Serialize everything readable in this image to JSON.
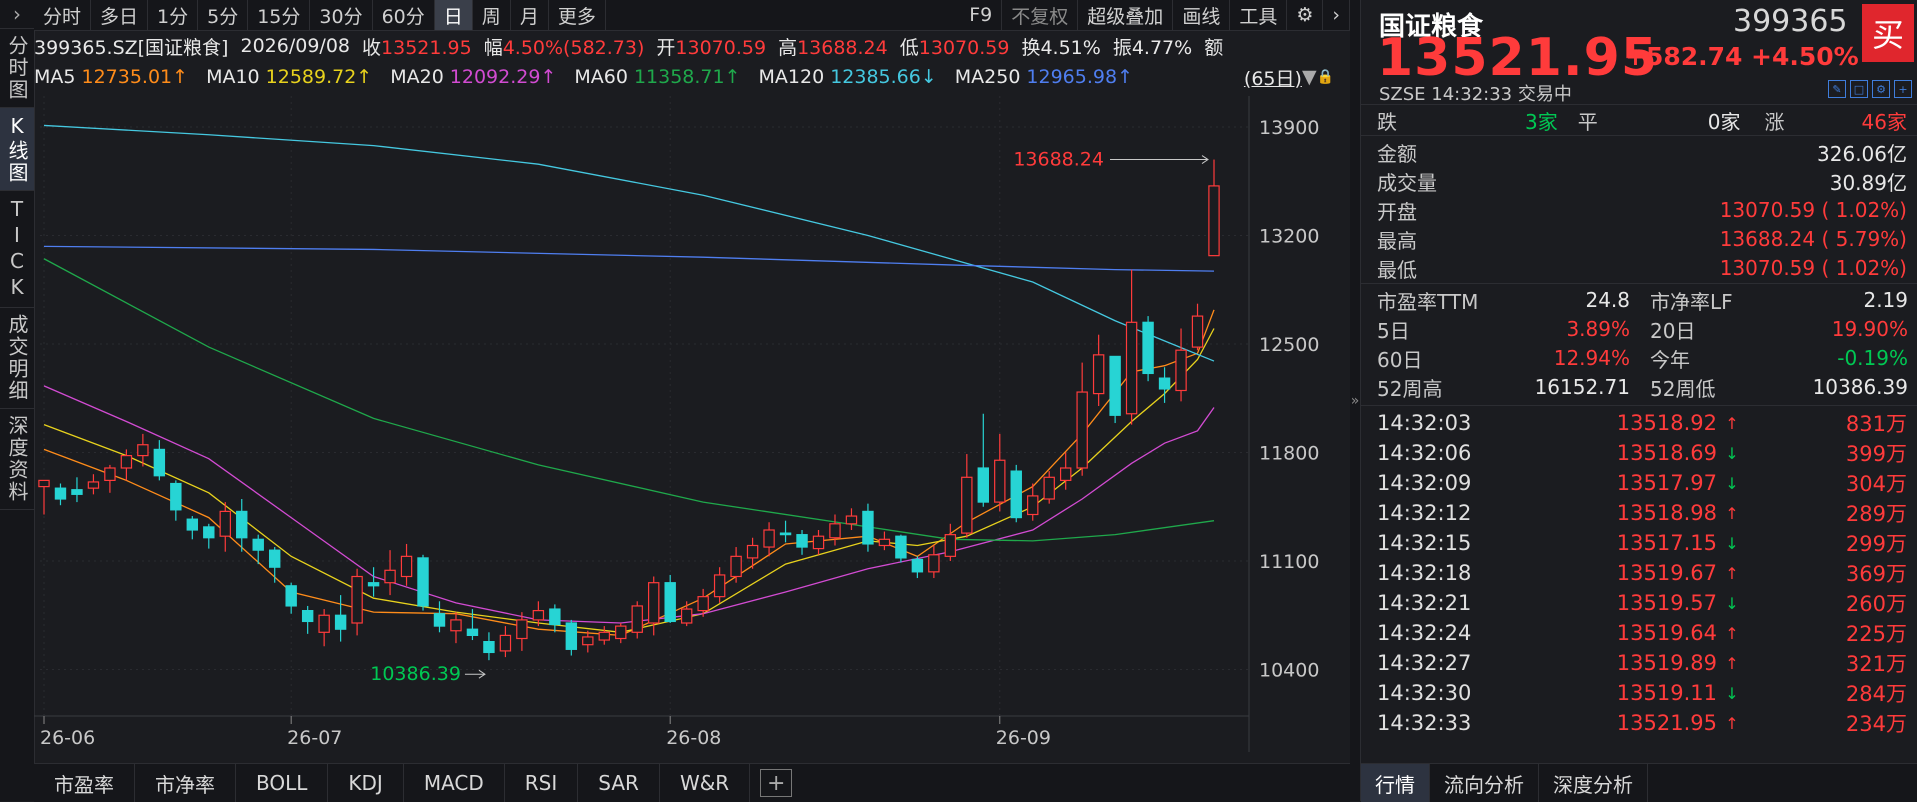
{
  "left_tabs": [
    {
      "label": "分时图"
    },
    {
      "label": "K线图",
      "active": true
    },
    {
      "label": "TICK"
    },
    {
      "label": "成交明细"
    },
    {
      "label": "深度资料"
    }
  ],
  "toolbar": {
    "periods": [
      "分时",
      "多日",
      "1分",
      "5分",
      "15分",
      "30分",
      "60分",
      "日",
      "周",
      "月",
      "更多"
    ],
    "active_period": "日",
    "right": [
      "F9",
      "不复权",
      "超级叠加",
      "画线",
      "工具"
    ],
    "gear_icon": "gear-icon",
    "next_icon": "chevron-right-icon",
    "collapse_icon": "chevron-right-icon"
  },
  "info": {
    "code_name": "399365.SZ[国证粮食]",
    "date": "2026/09/08",
    "close_label": "收",
    "close": "13521.95",
    "range_label": "幅",
    "range": "4.50%(582.73)",
    "open_label": "开",
    "open": "13070.59",
    "high_label": "高",
    "high": "13688.24",
    "low_label": "低",
    "low": "13070.59",
    "turnover_label": "换",
    "turnover": "4.51%",
    "amplitude_label": "振",
    "amplitude": "4.77%",
    "amount_label": "额"
  },
  "ma": {
    "items": [
      {
        "name": "MA5",
        "value": "12735.01↑",
        "color": "#ff8c1a"
      },
      {
        "name": "MA10",
        "value": "12589.72↑",
        "color": "#e8d21d"
      },
      {
        "name": "MA20",
        "value": "12092.29↑",
        "color": "#d24bd2"
      },
      {
        "name": "MA60",
        "value": "11358.71↑",
        "color": "#1fa84b"
      },
      {
        "name": "MA120",
        "value": "12385.66↓",
        "color": "#45c8e0"
      },
      {
        "name": "MA250",
        "value": "12965.98↑",
        "color": "#4f7ef0"
      }
    ],
    "days": "(65日)"
  },
  "chart_data": {
    "type": "candlestick",
    "ylim": [
      10100,
      14100
    ],
    "y_ticks": [
      "13900",
      "13200",
      "12500",
      "11800",
      "11100",
      "10400"
    ],
    "x_labels": [
      {
        "index": 0,
        "label": "26-06"
      },
      {
        "index": 15,
        "label": "26-07"
      },
      {
        "index": 38,
        "label": "26-08"
      },
      {
        "index": 58,
        "label": "26-09"
      }
    ],
    "max_label": "13688.24",
    "min_label": "10386.39",
    "candles": [
      [
        11580,
        11620,
        11400,
        11620
      ],
      [
        11570,
        11500,
        11460,
        11600
      ],
      [
        11560,
        11530,
        11480,
        11640
      ],
      [
        11570,
        11610,
        11530,
        11660
      ],
      [
        11620,
        11700,
        11540,
        11720
      ],
      [
        11700,
        11780,
        11620,
        11820
      ],
      [
        11780,
        11850,
        11710,
        11920
      ],
      [
        11820,
        11650,
        11620,
        11880
      ],
      [
        11600,
        11430,
        11360,
        11620
      ],
      [
        11370,
        11300,
        11240,
        11390
      ],
      [
        11320,
        11250,
        11180,
        11340
      ],
      [
        11260,
        11420,
        11160,
        11480
      ],
      [
        11420,
        11250,
        11160,
        11500
      ],
      [
        11240,
        11170,
        11080,
        11270
      ],
      [
        11170,
        11060,
        10960,
        11190
      ],
      [
        10940,
        10810,
        10760,
        10960
      ],
      [
        10780,
        10710,
        10630,
        10810
      ],
      [
        10640,
        10750,
        10550,
        10790
      ],
      [
        10750,
        10660,
        10580,
        10880
      ],
      [
        10700,
        11000,
        10620,
        11050
      ],
      [
        10960,
        10940,
        10870,
        11060
      ],
      [
        10960,
        11040,
        10880,
        11170
      ],
      [
        11000,
        11130,
        10940,
        11210
      ],
      [
        11120,
        10810,
        10780,
        11140
      ],
      [
        10760,
        10680,
        10640,
        10840
      ],
      [
        10650,
        10720,
        10570,
        10770
      ],
      [
        10660,
        10620,
        10590,
        10790
      ],
      [
        10580,
        10510,
        10460,
        10640
      ],
      [
        10520,
        10620,
        10480,
        10680
      ],
      [
        10600,
        10720,
        10520,
        10770
      ],
      [
        10720,
        10780,
        10680,
        10840
      ],
      [
        10790,
        10690,
        10640,
        10820
      ],
      [
        10700,
        10530,
        10490,
        10720
      ],
      [
        10560,
        10610,
        10510,
        10650
      ],
      [
        10590,
        10640,
        10560,
        10680
      ],
      [
        10600,
        10680,
        10570,
        10700
      ],
      [
        10640,
        10810,
        10600,
        10840
      ],
      [
        10700,
        10960,
        10620,
        11000
      ],
      [
        10960,
        10710,
        10700,
        11010
      ],
      [
        10700,
        10790,
        10680,
        10840
      ],
      [
        10780,
        10870,
        10740,
        10920
      ],
      [
        10870,
        11010,
        10830,
        11060
      ],
      [
        11000,
        11130,
        10960,
        11190
      ],
      [
        11120,
        11200,
        11050,
        11250
      ],
      [
        11190,
        11300,
        11130,
        11350
      ],
      [
        11280,
        11270,
        11220,
        11360
      ],
      [
        11270,
        11190,
        11140,
        11300
      ],
      [
        11180,
        11260,
        11140,
        11300
      ],
      [
        11250,
        11340,
        11200,
        11400
      ],
      [
        11340,
        11390,
        11300,
        11440
      ],
      [
        11420,
        11210,
        11160,
        11470
      ],
      [
        11200,
        11240,
        11170,
        11290
      ],
      [
        11260,
        11120,
        11090,
        11270
      ],
      [
        11110,
        11030,
        10990,
        11130
      ],
      [
        11030,
        11140,
        10990,
        11200
      ],
      [
        11130,
        11270,
        11100,
        11340
      ],
      [
        11280,
        11640,
        11250,
        11790
      ],
      [
        11700,
        11480,
        11450,
        12050
      ],
      [
        11480,
        11750,
        11420,
        11920
      ],
      [
        11680,
        11380,
        11350,
        11720
      ],
      [
        11400,
        11520,
        11360,
        11600
      ],
      [
        11500,
        11640,
        11470,
        11680
      ],
      [
        11620,
        11700,
        11560,
        11800
      ],
      [
        11700,
        12190,
        11650,
        12380
      ],
      [
        12180,
        12430,
        12100,
        12560
      ],
      [
        12420,
        12040,
        11990,
        12420
      ],
      [
        12050,
        12640,
        11980,
        12980
      ],
      [
        12640,
        12310,
        12260,
        12680
      ],
      [
        12280,
        12210,
        12120,
        12350
      ],
      [
        12200,
        12460,
        12130,
        12600
      ],
      [
        12480,
        12680,
        12460,
        12760
      ],
      [
        13070,
        13520,
        13070,
        13690
      ]
    ],
    "ma_series": [
      {
        "name": "MA5",
        "values": [
          [
            0,
            11820
          ],
          [
            5,
            11620
          ],
          [
            10,
            11380
          ],
          [
            15,
            10900
          ],
          [
            20,
            10770
          ],
          [
            25,
            10760
          ],
          [
            30,
            10660
          ],
          [
            35,
            10620
          ],
          [
            40,
            10860
          ],
          [
            45,
            11210
          ],
          [
            50,
            11260
          ],
          [
            53,
            11130
          ],
          [
            56,
            11350
          ],
          [
            60,
            11580
          ],
          [
            63,
            11920
          ],
          [
            66,
            12320
          ],
          [
            68,
            12360
          ],
          [
            70,
            12440
          ],
          [
            71,
            12720
          ]
        ]
      },
      {
        "name": "MA10",
        "values": [
          [
            0,
            11980
          ],
          [
            5,
            11780
          ],
          [
            10,
            11540
          ],
          [
            15,
            11130
          ],
          [
            20,
            10860
          ],
          [
            25,
            10770
          ],
          [
            30,
            10700
          ],
          [
            35,
            10640
          ],
          [
            40,
            10760
          ],
          [
            45,
            11080
          ],
          [
            50,
            11230
          ],
          [
            53,
            11200
          ],
          [
            56,
            11260
          ],
          [
            60,
            11450
          ],
          [
            63,
            11700
          ],
          [
            66,
            12000
          ],
          [
            68,
            12180
          ],
          [
            70,
            12400
          ],
          [
            71,
            12600
          ]
        ]
      },
      {
        "name": "MA20",
        "values": [
          [
            0,
            12230
          ],
          [
            5,
            12000
          ],
          [
            10,
            11760
          ],
          [
            15,
            11380
          ],
          [
            20,
            11000
          ],
          [
            25,
            10830
          ],
          [
            30,
            10720
          ],
          [
            35,
            10700
          ],
          [
            40,
            10760
          ],
          [
            45,
            10900
          ],
          [
            50,
            11050
          ],
          [
            55,
            11160
          ],
          [
            60,
            11300
          ],
          [
            63,
            11500
          ],
          [
            66,
            11730
          ],
          [
            68,
            11860
          ],
          [
            70,
            11940
          ],
          [
            71,
            12090
          ]
        ]
      },
      {
        "name": "MA60",
        "values": [
          [
            0,
            13050
          ],
          [
            10,
            12480
          ],
          [
            20,
            12020
          ],
          [
            30,
            11720
          ],
          [
            40,
            11480
          ],
          [
            50,
            11320
          ],
          [
            55,
            11240
          ],
          [
            60,
            11230
          ],
          [
            65,
            11270
          ],
          [
            71,
            11360
          ]
        ]
      },
      {
        "name": "MA120",
        "values": [
          [
            0,
            13910
          ],
          [
            10,
            13850
          ],
          [
            20,
            13780
          ],
          [
            30,
            13660
          ],
          [
            40,
            13460
          ],
          [
            50,
            13200
          ],
          [
            60,
            12900
          ],
          [
            65,
            12650
          ],
          [
            71,
            12390
          ]
        ]
      },
      {
        "name": "MA250",
        "values": [
          [
            0,
            13130
          ],
          [
            20,
            13110
          ],
          [
            40,
            13060
          ],
          [
            55,
            13010
          ],
          [
            65,
            12980
          ],
          [
            71,
            12970
          ]
        ]
      }
    ]
  },
  "indicator_tabs": [
    "市盈率",
    "市净率",
    "BOLL",
    "KDJ",
    "MACD",
    "RSI",
    "SAR",
    "W&R"
  ],
  "panel": {
    "name": "国证粮食",
    "code": "399365",
    "buy_label": "买",
    "price": "13521.95",
    "change": "+582.74",
    "change_pct": "+4.50%",
    "exchange_time": "SZSE  14:32:33  交易中",
    "breadth": {
      "down_label": "跌",
      "down": "3家",
      "flat_label": "平",
      "flat": "0家",
      "up_label": "涨",
      "up": "46家"
    },
    "stats": [
      {
        "label": "金额",
        "value": "326.06亿",
        "color": "white"
      },
      {
        "label": "成交量",
        "value": "30.89亿",
        "color": "white"
      },
      {
        "label": "开盘",
        "value": "13070.59 ( 1.02%)",
        "color": "red"
      },
      {
        "label": "最高",
        "value": "13688.24 ( 5.79%)",
        "color": "red"
      },
      {
        "label": "最低",
        "value": "13070.59 ( 1.02%)",
        "color": "red"
      }
    ],
    "pairs": [
      [
        {
          "label": "市盈率TTM",
          "value": "24.8",
          "color": "white"
        },
        {
          "label": "市净率LF",
          "value": "2.19",
          "color": "white"
        }
      ],
      [
        {
          "label": "5日",
          "value": "3.89%",
          "color": "red"
        },
        {
          "label": "20日",
          "value": "19.90%",
          "color": "red"
        }
      ],
      [
        {
          "label": "60日",
          "value": "12.94%",
          "color": "red"
        },
        {
          "label": "今年",
          "value": "-0.19%",
          "color": "green"
        }
      ],
      [
        {
          "label": "52周高",
          "value": "16152.71",
          "color": "white"
        },
        {
          "label": "52周低",
          "value": "10386.39",
          "color": "white"
        }
      ]
    ],
    "ticks": [
      {
        "time": "14:32:03",
        "price": "13518.92",
        "dir": "up",
        "vol": "831万"
      },
      {
        "time": "14:32:06",
        "price": "13518.69",
        "dir": "down",
        "vol": "399万"
      },
      {
        "time": "14:32:09",
        "price": "13517.97",
        "dir": "down",
        "vol": "304万"
      },
      {
        "time": "14:32:12",
        "price": "13518.98",
        "dir": "up",
        "vol": "289万"
      },
      {
        "time": "14:32:15",
        "price": "13517.15",
        "dir": "down",
        "vol": "299万"
      },
      {
        "time": "14:32:18",
        "price": "13519.67",
        "dir": "up",
        "vol": "369万"
      },
      {
        "time": "14:32:21",
        "price": "13519.57",
        "dir": "down",
        "vol": "260万"
      },
      {
        "time": "14:32:24",
        "price": "13519.64",
        "dir": "up",
        "vol": "225万"
      },
      {
        "time": "14:32:27",
        "price": "13519.89",
        "dir": "up",
        "vol": "321万"
      },
      {
        "time": "14:32:30",
        "price": "13519.11",
        "dir": "down",
        "vol": "284万"
      },
      {
        "time": "14:32:33",
        "price": "13521.95",
        "dir": "up",
        "vol": "234万"
      }
    ],
    "tabs": [
      "行情",
      "流向分析",
      "深度分析"
    ],
    "active_tab": "行情"
  },
  "colors": {
    "up": "#ff3b3b",
    "down": "#27d4d4",
    "grid": "#2a2b30",
    "bg": "#1b1c20"
  }
}
